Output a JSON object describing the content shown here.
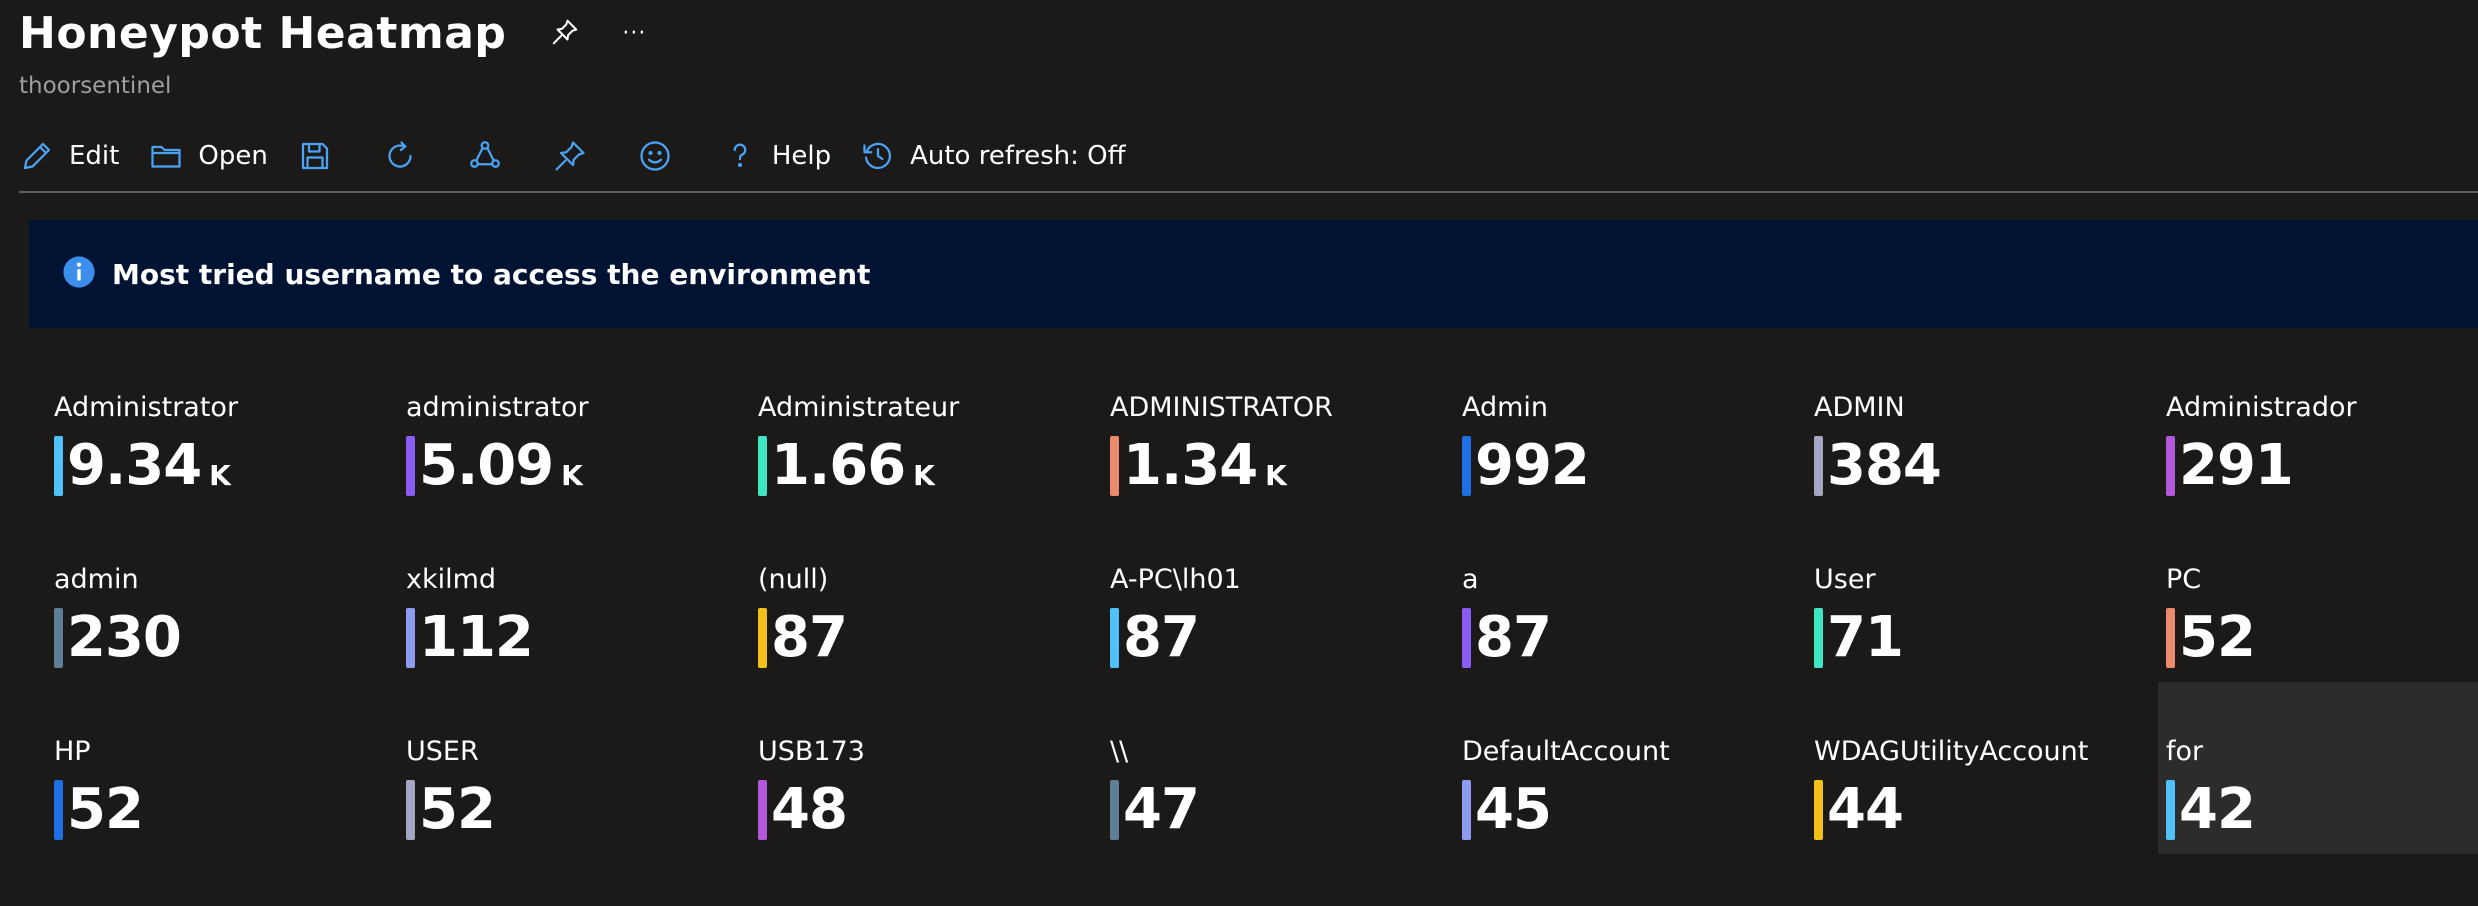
{
  "header": {
    "title": "Honeypot Heatmap",
    "subtitle": "thoorsentinel",
    "pin_icon": "pin-icon",
    "more_icon": "ellipsis-icon",
    "more_text": "···"
  },
  "toolbar": {
    "edit_label": "Edit",
    "open_label": "Open",
    "save_icon": "save-icon",
    "refresh_icon": "refresh-icon",
    "share_icon": "share-icon",
    "pin_icon": "pin-icon",
    "feedback_icon": "smiley-icon",
    "help_label": "Help",
    "autorefresh_label": "Auto refresh: Off"
  },
  "banner": {
    "icon": "info-icon",
    "text": "Most tried username to access the environment"
  },
  "colors": {
    "background": "#1b1a19",
    "banner_background": "#001333",
    "toolbar_icon": "#4aa3f5"
  },
  "tiles": [
    {
      "label": "Administrator",
      "value": "9.34",
      "unit": "K",
      "color": "#4fc3f7"
    },
    {
      "label": "administrator",
      "value": "5.09",
      "unit": "K",
      "color": "#8a5cf6"
    },
    {
      "label": "Administrateur",
      "value": "1.66",
      "unit": "K",
      "color": "#3ee8c2"
    },
    {
      "label": "ADMINISTRATOR",
      "value": "1.34",
      "unit": "K",
      "color": "#ec8a6c"
    },
    {
      "label": "Admin",
      "value": "992",
      "unit": "",
      "color": "#1f6fe5"
    },
    {
      "label": "ADMIN",
      "value": "384",
      "unit": "",
      "color": "#a5a6c2"
    },
    {
      "label": "Administrador",
      "value": "291",
      "unit": "",
      "color": "#b358dd"
    },
    {
      "label": "admin",
      "value": "230",
      "unit": "",
      "color": "#5e7f95"
    },
    {
      "label": "xkilmd",
      "value": "112",
      "unit": "",
      "color": "#8e9bf0"
    },
    {
      "label": "(null)",
      "value": "87",
      "unit": "",
      "color": "#f2c21b"
    },
    {
      "label": "A-PC\\lh01",
      "value": "87",
      "unit": "",
      "color": "#4fc3f7"
    },
    {
      "label": "a",
      "value": "87",
      "unit": "",
      "color": "#8a5cf6"
    },
    {
      "label": "User",
      "value": "71",
      "unit": "",
      "color": "#3ee8c2"
    },
    {
      "label": "PC",
      "value": "52",
      "unit": "",
      "color": "#ec8a6c"
    },
    {
      "label": "HP",
      "value": "52",
      "unit": "",
      "color": "#1f6fe5"
    },
    {
      "label": "USER",
      "value": "52",
      "unit": "",
      "color": "#a5a6c2"
    },
    {
      "label": "USB173",
      "value": "48",
      "unit": "",
      "color": "#b358dd"
    },
    {
      "label": "\\\\",
      "value": "47",
      "unit": "",
      "color": "#5e7f95"
    },
    {
      "label": "DefaultAccount",
      "value": "45",
      "unit": "",
      "color": "#8e9bf0"
    },
    {
      "label": "WDAGUtilityAccount",
      "value": "44",
      "unit": "",
      "color": "#f2c21b"
    },
    {
      "label": "for",
      "value": "42",
      "unit": "",
      "color": "#4fc3f7",
      "highlighted": true
    }
  ]
}
